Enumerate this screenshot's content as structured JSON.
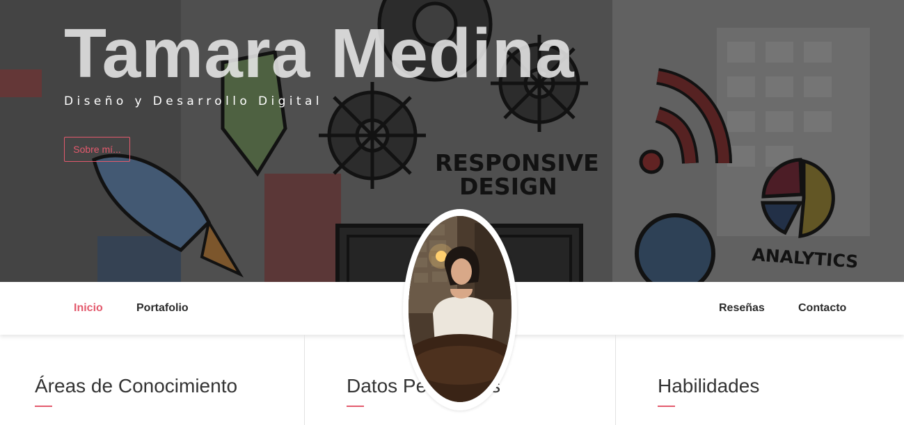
{
  "hero": {
    "title": "Tamara Medina",
    "subtitle": "Diseño y Desarrollo Digital",
    "about_button": "Sobre mí..."
  },
  "nav": {
    "left_links": [
      "Inicio",
      "Portafolio"
    ],
    "right_links": [
      "Reseñas",
      "Contacto"
    ],
    "active": "Inicio"
  },
  "illustration": {
    "responsive_text_1": "RESPONSIVE",
    "responsive_text_2": "DESIGN",
    "analytics_text": "ANALYTICS"
  },
  "sections": [
    {
      "title": "Áreas de Conocimiento"
    },
    {
      "title": "Datos Personales"
    },
    {
      "title": "Habilidades"
    }
  ],
  "colors": {
    "accent": "#e35a6d",
    "text_dark": "#2b2b2b",
    "divider": "#e2e2e2"
  }
}
